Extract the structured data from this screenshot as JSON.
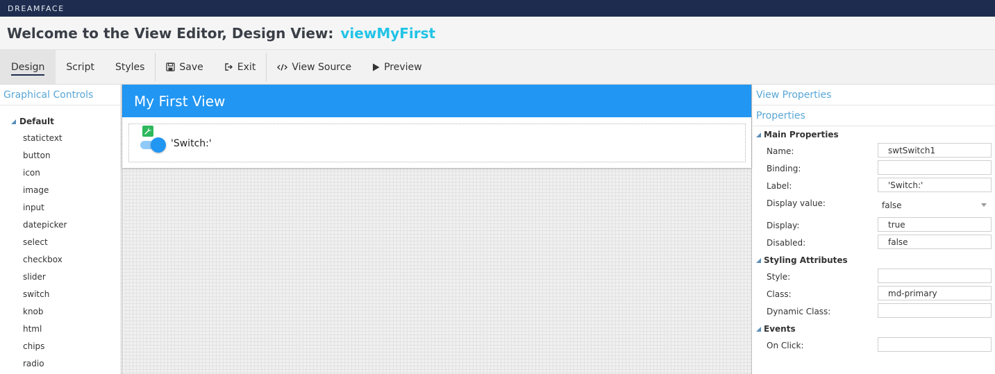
{
  "brand": "DREAMFACE",
  "title": {
    "prefix": "Welcome to the View Editor, Design View:",
    "view_name": "viewMyFirst"
  },
  "toolbar": {
    "design": "Design",
    "script": "Script",
    "styles": "Styles",
    "save": "Save",
    "exit": "Exit",
    "view_source": "View Source",
    "preview": "Preview"
  },
  "left_panel": {
    "header": "Graphical Controls",
    "group": "Default",
    "items": [
      "statictext",
      "button",
      "icon",
      "image",
      "input",
      "datepicker",
      "select",
      "checkbox",
      "slider",
      "switch",
      "knob",
      "html",
      "chips",
      "radio"
    ]
  },
  "canvas": {
    "view_title": "My First View",
    "switch_label": "'Switch:'",
    "switch_on": true
  },
  "right_panel": {
    "header1": "View Properties",
    "header2": "Properties",
    "main_section": "Main Properties",
    "name_label": "Name:",
    "name_value": "swtSwitch1",
    "binding_label": "Binding:",
    "binding_value": "",
    "label_label": "Label:",
    "label_value": "'Switch:'",
    "display_value_label": "Display value:",
    "display_value_value": "false",
    "display_label": "Display:",
    "display_value": "true",
    "disabled_label": "Disabled:",
    "disabled_value": "false",
    "styling_section": "Styling Attributes",
    "style_label": "Style:",
    "style_value": "",
    "class_label": "Class:",
    "class_value": "md-primary",
    "dynamic_class_label": "Dynamic Class:",
    "dynamic_class_value": "",
    "events_section": "Events",
    "on_click_label": "On Click:",
    "on_click_value": ""
  },
  "colors": {
    "brand_bar": "#1e2d4f",
    "accent": "#22c3e6",
    "view_header": "#2196f3",
    "panel_header": "#58a6d6"
  }
}
